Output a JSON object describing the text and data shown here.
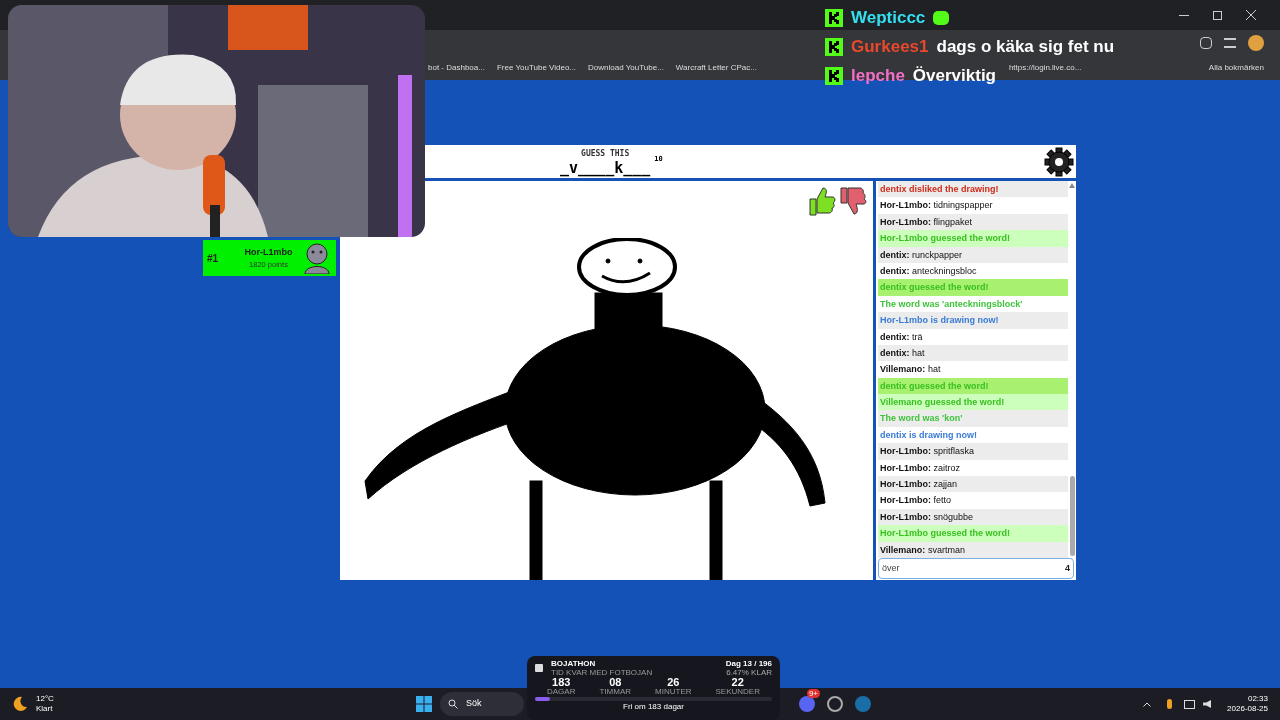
{
  "browser": {
    "bookmarks": [
      {
        "label": "bot - Dashboa..."
      },
      {
        "label": "Free YouTube Video..."
      },
      {
        "label": "Download YouTube..."
      },
      {
        "label": "Warcraft Letter CPac..."
      },
      {
        "label": "https://login.live.co..."
      }
    ],
    "all_bookmarks": "Alla bokmärken"
  },
  "stream_chat": [
    {
      "name": "Wepticcc",
      "color": "#33e0f0"
    },
    {
      "name": "Gurkees1",
      "color": "#e8482c",
      "message": "dags o käka sig fet nu"
    },
    {
      "name": "lepche",
      "color": "#f070c8",
      "message": "Överviktig"
    }
  ],
  "game": {
    "header": {
      "label": "GUESS THIS",
      "word": "_v____k___",
      "letters": "10"
    },
    "players": [
      {
        "rank": "#1",
        "name": "Hor-L1mbo",
        "points": "1820 points",
        "selected": true
      }
    ],
    "chat": [
      {
        "kind": "disliked",
        "text": "dentix disliked the drawing!"
      },
      {
        "kind": "message",
        "name": "Hor-L1mbo:",
        "text": "tidningspapper"
      },
      {
        "kind": "message",
        "name": "Hor-L1mbo:",
        "text": "flingpaket"
      },
      {
        "kind": "guessed",
        "text": "Hor-L1mbo guessed the word!"
      },
      {
        "kind": "message",
        "name": "dentix:",
        "text": "runckpapper"
      },
      {
        "kind": "message",
        "name": "dentix:",
        "text": "anteckningsbloc"
      },
      {
        "kind": "guessed",
        "text": "dentix guessed the word!"
      },
      {
        "kind": "word",
        "text": "The word was 'anteckningsblock'"
      },
      {
        "kind": "drawing",
        "text": "Hor-L1mbo is drawing now!"
      },
      {
        "kind": "message",
        "name": "dentix:",
        "text": "trä"
      },
      {
        "kind": "message",
        "name": "dentix:",
        "text": "hat"
      },
      {
        "kind": "message",
        "name": "Villemano:",
        "text": "hat"
      },
      {
        "kind": "guessed",
        "text": "dentix guessed the word!"
      },
      {
        "kind": "guessed",
        "text": "Villemano guessed the word!"
      },
      {
        "kind": "word",
        "text": "The word was 'kon'"
      },
      {
        "kind": "drawing",
        "text": "dentix is drawing now!"
      },
      {
        "kind": "message",
        "name": "Hor-L1mbo:",
        "text": "spritflaska"
      },
      {
        "kind": "message",
        "name": "Hor-L1mbo:",
        "text": "zaitroz"
      },
      {
        "kind": "message",
        "name": "Hor-L1mbo:",
        "text": "zajjan"
      },
      {
        "kind": "message",
        "name": "Hor-L1mbo:",
        "text": "fetto"
      },
      {
        "kind": "message",
        "name": "Hor-L1mbo:",
        "text": "snögubbe"
      },
      {
        "kind": "guessed",
        "text": "Hor-L1mbo guessed the word!"
      },
      {
        "kind": "message",
        "name": "Villemano:",
        "text": "svartman"
      }
    ],
    "input": {
      "value": "över",
      "count": "4"
    }
  },
  "widget": {
    "title": "BOJATHON",
    "subtitle": "TID KVAR MED FOTBOJAN",
    "day": "Dag 13 / 196",
    "percent": "6.47% KLAR",
    "counters": [
      {
        "value": "183",
        "label": "DAGAR"
      },
      {
        "value": "08",
        "label": "TIMMAR"
      },
      {
        "value": "26",
        "label": "MINUTER"
      },
      {
        "value": "22",
        "label": "SEKUNDER"
      }
    ],
    "level": 0.0647,
    "footer": "Fri om 183 dagar"
  },
  "taskbar": {
    "temperature": "12°C",
    "weather": "Klart",
    "search": "Sök",
    "discord_badge": "9+",
    "time": "02:33",
    "date": "2026-08-25"
  }
}
